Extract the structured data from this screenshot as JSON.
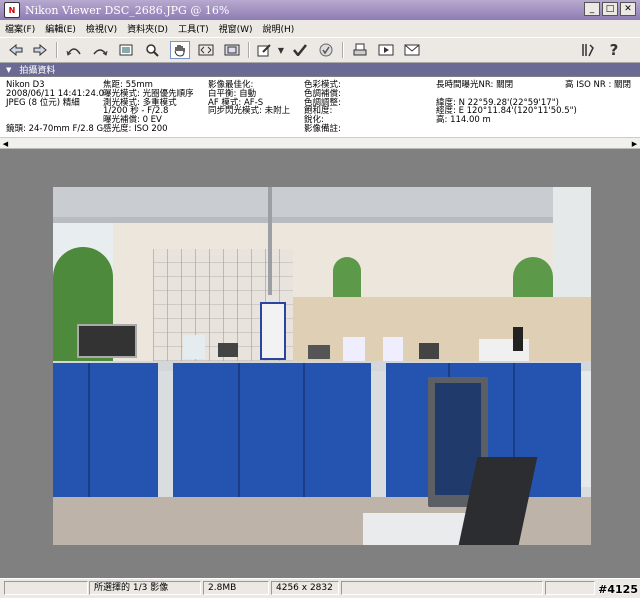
{
  "window": {
    "title": "Nikon Viewer DSC_2686.JPG @ 16%",
    "minimize": "_",
    "maximize": "□",
    "close": "✕"
  },
  "menu": [
    "檔案(F)",
    "編輯(E)",
    "檢視(V)",
    "資料夾(D)",
    "工具(T)",
    "視窗(W)",
    "說明(H)"
  ],
  "toolbar": {
    "icons": [
      "back-icon",
      "forward-icon",
      "rotate-left-icon",
      "rotate-right-icon",
      "slideshow-icon",
      "zoom-icon",
      "hand-icon",
      "fit-screen-icon",
      "full-screen-icon",
      "edit-icon",
      "check-mark-icon",
      "protect-icon",
      "print-icon",
      "transfer-icon",
      "email-icon",
      "settings-icon",
      "help-icon"
    ]
  },
  "info_panel": {
    "label": "拍攝資料",
    "col1": [
      "Nikon D3",
      "2008/06/11 14:41:24.0",
      "JPEG (8 位元) 精細",
      "",
      "",
      "鏡頭: 24-70mm F/2.8 G"
    ],
    "col2": [
      "焦距: 55mm",
      "曝光模式: 光圈優先順序",
      "測光模式: 多重模式",
      "1/200 秒 - F/2.8",
      "曝光補償: 0 EV",
      "感光度: ISO 200"
    ],
    "col3": [
      "影像最佳化:",
      "白平衡: 自動",
      "AF 模式: AF-S",
      "同步閃光模式: 未附上"
    ],
    "col4": [
      "色彩模式:",
      "色調補償:",
      "色調調整:",
      "飽和度:",
      "銳化:",
      "影像備註:"
    ],
    "col5": [
      "長時間曝光NR: 關閉",
      "",
      "緯度: N 22°59.28'(22°59'17\")",
      "經度: E 120°11.84'(120°11'50.5\")",
      "高: 114.00 m"
    ],
    "col6": [
      "高 ISO NR : 關閉"
    ]
  },
  "status": {
    "selection": "所選擇的 1/3 影像",
    "size": "2.8MB",
    "dimensions": "4256 x 2832"
  },
  "watermark": "#4125"
}
